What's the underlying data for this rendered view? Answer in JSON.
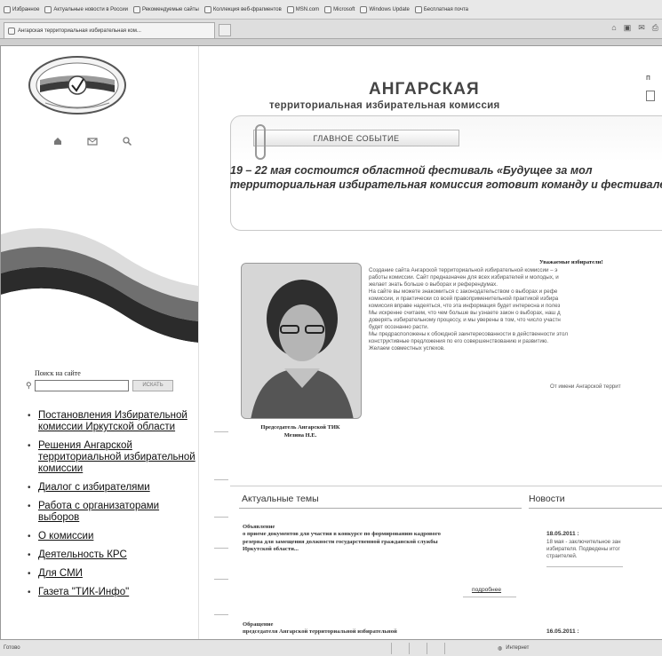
{
  "browser": {
    "favorites": [
      "Избранное",
      "Актуальные новости в России",
      "Рекомендуемые сайты",
      "Коллекция веб-фрагментов",
      "MSN.com",
      "Microsoft",
      "Windows Update",
      "Бесплатная почта"
    ],
    "tab_title": "Ангарская территориальная избирательная ком...",
    "status_left": "Готово",
    "status_zone": "Интернет"
  },
  "sidebar": {
    "search_label": "Поиск на сайте",
    "search_value": "",
    "search_button": "ИСКАТЬ",
    "nav": [
      "Постановления Избирательной комиссии Иркутской области",
      "Решения Ангарской территориальной избирательной комиссии",
      "Диалог с избирателями",
      "Работа с организаторами выборов",
      "О комиссии",
      "Деятельность КРС",
      "Для СМИ",
      "Газета \"ТИК-Инфо\""
    ]
  },
  "header": {
    "title": "АНГАРСКАЯ",
    "subtitle": "территориальная избирательная комиссия",
    "topright": "п"
  },
  "event": {
    "tab_label": "ГЛАВНОЕ СОБЫТИЕ",
    "text": "19 – 22 мая состоится областной фестиваль «Будущее за мол территориальная избирательная комиссия готовит команду и фестивале."
  },
  "chair": {
    "caption_line1": "Председатель Ангарской ТИК",
    "caption_line2": "Мезина Н.Е.",
    "greeting_title": "Уважаемые избиратели!",
    "greeting_lines": [
      "Создание сайта Ангарской территориальной избирательной комиссии – э",
      "работы комиссии. Сайт предназначен для всех избирателей и молодых, и",
      "желает знать больше о выборах и референдумах.",
      "На сайте вы можете знакомиться с законодательством о выборах и рефе",
      "комиссии, и практически со всей правоприменительной практикой избира",
      "комиссия вправе надеяться, что эта информация будет интересна и полез",
      "Мы искренне считаем, что чем больше вы узнаете закон о выборах, наш д",
      "доверять избирательному процессу, и мы уверены в том, что число участн",
      "будет осознанно расти.",
      "Мы предрасположены к обоюдной заинтересованности в действенности этол",
      "конструктивные предложения по его совершенствованию и развитию.",
      "Желаем совместных успехов."
    ],
    "signature": "От имени Ангарской террит"
  },
  "topics": {
    "heading": "Актуальные темы",
    "item1": [
      "Объявление",
      "о приеме документов для участия в конкурсе по формированию кадрового",
      "резерва для замещения должности государственной гражданской службы",
      "Иркутской области..."
    ],
    "item1_more": "подробнее",
    "item2": [
      "Обращение",
      "председателя Ангарской территориальной избирательной"
    ]
  },
  "news": {
    "heading": "Новости",
    "item1_date": "18.05.2011 :",
    "item1_lines": [
      "18 мая - заключительное зан",
      "избирателя. Подведены итог",
      "страителей."
    ],
    "item2_date": "16.05.2011 :"
  }
}
